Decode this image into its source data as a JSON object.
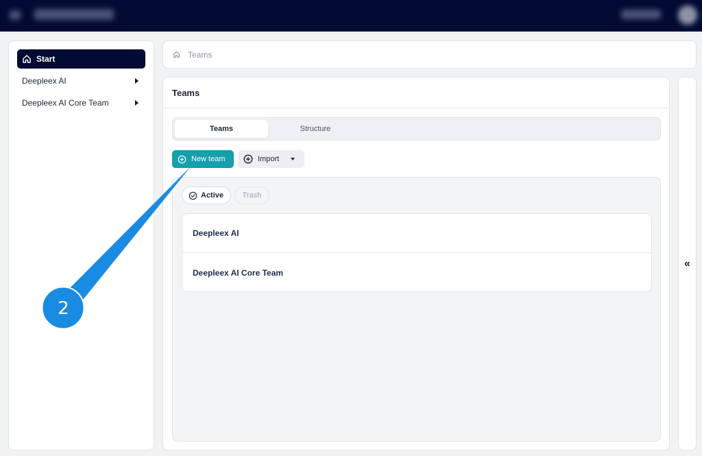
{
  "colors": {
    "topbar": "#020b33",
    "accent": "#14a0ad",
    "callout": "#1a8be3"
  },
  "sidebar": {
    "items": [
      {
        "label": "Start",
        "icon": "home-icon"
      },
      {
        "label": "Deepleex AI",
        "icon": "caret-right-icon"
      },
      {
        "label": "Deepleex AI Core Team",
        "icon": "caret-right-icon"
      }
    ]
  },
  "breadcrumb": {
    "label": "Teams",
    "icon": "home-icon"
  },
  "main": {
    "title": "Teams",
    "tabs": [
      {
        "label": "Teams"
      },
      {
        "label": "Structure"
      }
    ],
    "actions": {
      "new_team": "New team",
      "import": "Import"
    },
    "filters": {
      "active": "Active",
      "trash": "Trash"
    },
    "teams": [
      {
        "name": "Deepleex AI"
      },
      {
        "name": "Deepleex AI Core Team"
      }
    ]
  },
  "right_panel": {
    "toggle_label": "«"
  },
  "callout": {
    "number": "2"
  }
}
